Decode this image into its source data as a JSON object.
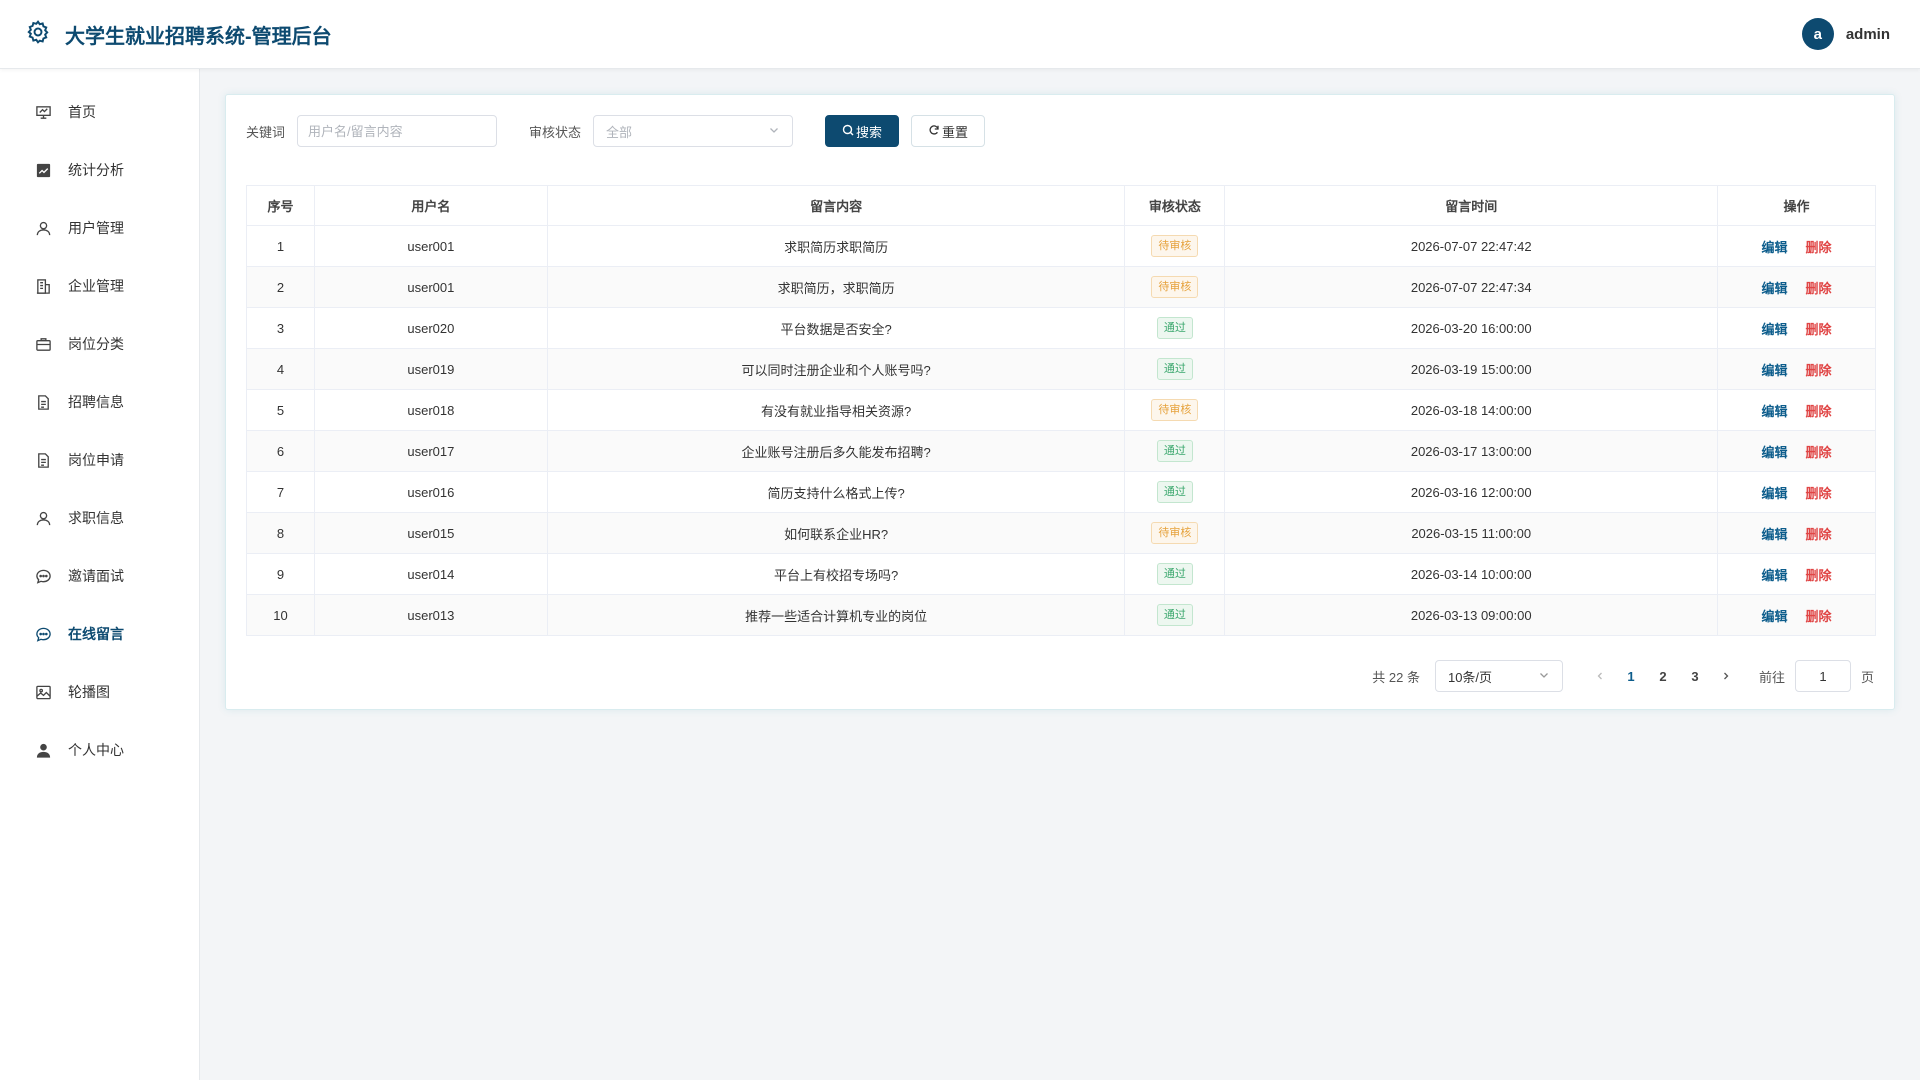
{
  "header": {
    "title": "大学生就业招聘系统-管理后台",
    "avatar_letter": "a",
    "username": "admin",
    "brand_color": "#0d4a70"
  },
  "sidebar": {
    "items": [
      {
        "label": "首页",
        "icon": "presentation-board-icon"
      },
      {
        "label": "统计分析",
        "icon": "chart-icon"
      },
      {
        "label": "用户管理",
        "icon": "user-icon"
      },
      {
        "label": "企业管理",
        "icon": "office-building-icon"
      },
      {
        "label": "岗位分类",
        "icon": "briefcase-icon"
      },
      {
        "label": "招聘信息",
        "icon": "document-icon"
      },
      {
        "label": "岗位申请",
        "icon": "document-icon"
      },
      {
        "label": "求职信息",
        "icon": "user-icon"
      },
      {
        "label": "邀请面试",
        "icon": "chat-bubble-icon"
      },
      {
        "label": "在线留言",
        "icon": "chat-bubble-icon",
        "active": true
      },
      {
        "label": "轮播图",
        "icon": "picture-icon"
      },
      {
        "label": "个人中心",
        "icon": "user-filled-icon"
      }
    ]
  },
  "filter": {
    "keyword_label": "关键词",
    "keyword_placeholder": "用户名/留言内容",
    "status_label": "审核状态",
    "status_value": "全部",
    "search_button": "搜索",
    "reset_button": "重置"
  },
  "table": {
    "columns": [
      "序号",
      "用户名",
      "留言内容",
      "审核状态",
      "留言时间",
      "操作"
    ],
    "edit_label": "编辑",
    "delete_label": "删除",
    "rows": [
      {
        "no": "1",
        "user": "user001",
        "content": "求职简历求职简历",
        "status": "待审核",
        "status_type": "pending",
        "time": "2026-07-07 22:47:42"
      },
      {
        "no": "2",
        "user": "user001",
        "content": "求职简历，求职简历",
        "status": "待审核",
        "status_type": "pending",
        "time": "2026-07-07 22:47:34"
      },
      {
        "no": "3",
        "user": "user020",
        "content": "平台数据是否安全?",
        "status": "通过",
        "status_type": "pass",
        "time": "2026-03-20 16:00:00"
      },
      {
        "no": "4",
        "user": "user019",
        "content": "可以同时注册企业和个人账号吗?",
        "status": "通过",
        "status_type": "pass",
        "time": "2026-03-19 15:00:00"
      },
      {
        "no": "5",
        "user": "user018",
        "content": "有没有就业指导相关资源?",
        "status": "待审核",
        "status_type": "pending",
        "time": "2026-03-18 14:00:00"
      },
      {
        "no": "6",
        "user": "user017",
        "content": "企业账号注册后多久能发布招聘?",
        "status": "通过",
        "status_type": "pass",
        "time": "2026-03-17 13:00:00"
      },
      {
        "no": "7",
        "user": "user016",
        "content": "简历支持什么格式上传?",
        "status": "通过",
        "status_type": "pass",
        "time": "2026-03-16 12:00:00"
      },
      {
        "no": "8",
        "user": "user015",
        "content": "如何联系企业HR?",
        "status": "待审核",
        "status_type": "pending",
        "time": "2026-03-15 11:00:00"
      },
      {
        "no": "9",
        "user": "user014",
        "content": "平台上有校招专场吗?",
        "status": "通过",
        "status_type": "pass",
        "time": "2026-03-14 10:00:00"
      },
      {
        "no": "10",
        "user": "user013",
        "content": "推荐一些适合计算机专业的岗位",
        "status": "通过",
        "status_type": "pass",
        "time": "2026-03-13 09:00:00"
      }
    ]
  },
  "pagination": {
    "total_text": "共 22 条",
    "page_size": "10条/页",
    "pages": [
      "1",
      "2",
      "3"
    ],
    "current_page": "1",
    "goto_label": "前往",
    "goto_value": "1",
    "page_suffix": "页"
  },
  "colors": {
    "pending": "#e6a23c",
    "pass": "#3aa76d",
    "edit": "#0d5d8c",
    "delete": "#e04545"
  }
}
